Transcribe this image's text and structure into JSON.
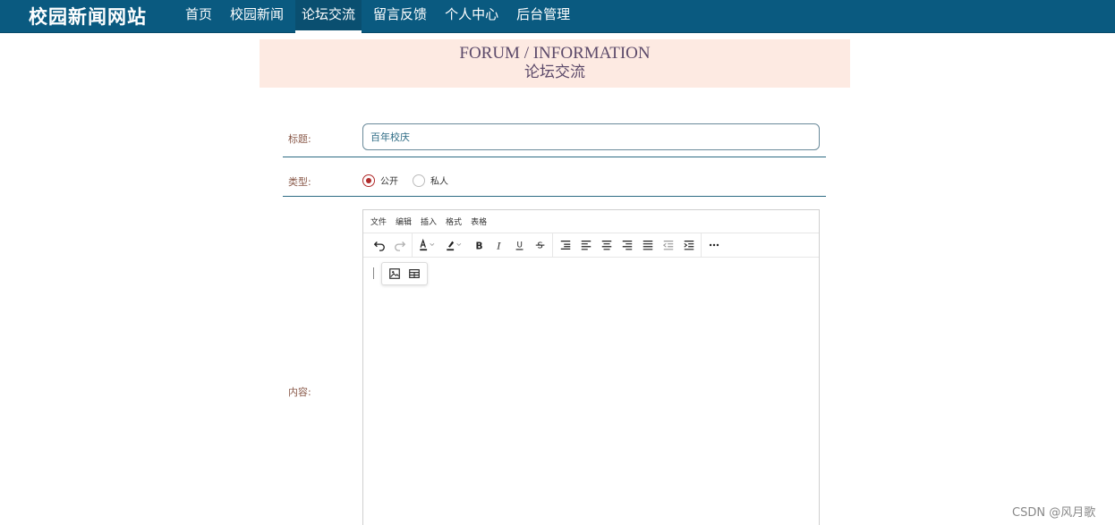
{
  "header": {
    "site_title": "校园新闻网站",
    "nav": [
      {
        "label": "首页",
        "active": false
      },
      {
        "label": "校园新闻",
        "active": false
      },
      {
        "label": "论坛交流",
        "active": true
      },
      {
        "label": "留言反馈",
        "active": false
      },
      {
        "label": "个人中心",
        "active": false
      },
      {
        "label": "后台管理",
        "active": false
      }
    ]
  },
  "banner": {
    "en": "FORUM / INFORMATION",
    "cn": "论坛交流"
  },
  "form": {
    "title_label": "标题:",
    "title_value": "百年校庆",
    "type_label": "类型:",
    "type_options": [
      {
        "label": "公开",
        "checked": true
      },
      {
        "label": "私人",
        "checked": false
      }
    ],
    "content_label": "内容:"
  },
  "editor": {
    "menus": [
      "文件",
      "编辑",
      "插入",
      "格式",
      "表格"
    ],
    "toolbar_icons": [
      "undo-icon",
      "redo-icon",
      "text-color-icon",
      "highlight-color-icon",
      "bold-icon",
      "italic-icon",
      "underline-icon",
      "strikethrough-icon",
      "line-height-icon",
      "align-left-icon",
      "align-center-icon",
      "align-right-icon",
      "align-justify-icon",
      "outdent-icon",
      "indent-icon",
      "more-icon"
    ],
    "quick_insert_icons": [
      "image-icon",
      "table-icon"
    ]
  },
  "watermark": "CSDN @风月歌",
  "colors": {
    "header_bg": "#0a5a80",
    "banner_bg": "#fdeae2",
    "accent_red": "#b02a2a",
    "divider": "#2d6b84"
  }
}
